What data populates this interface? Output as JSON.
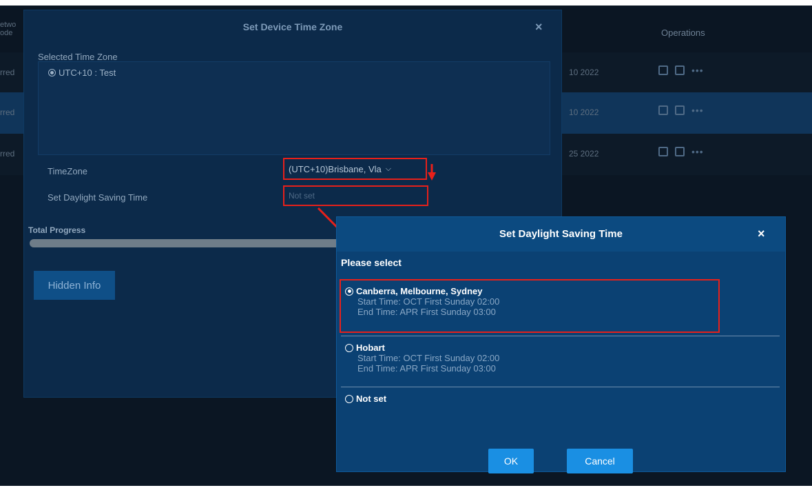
{
  "background": {
    "col_cut_top": "etwo",
    "col_cut_bottom": "ode",
    "operations_header": "Operations",
    "rows": [
      {
        "left": "rred",
        "date": "10 2022"
      },
      {
        "left": "rred",
        "date": "10 2022"
      },
      {
        "left": "rred",
        "date": "25 2022"
      }
    ]
  },
  "main_dialog": {
    "title": "Set Device Time Zone",
    "close": "×",
    "selected_label": "Selected Time Zone",
    "selected_item": "UTC+10 : Test",
    "timezone_label": "TimeZone",
    "timezone_value": "(UTC+10)Brisbane, Vla",
    "dst_label": "Set Daylight Saving Time",
    "dst_value": "Not set",
    "progress_label": "Total Progress",
    "progress": 1.0,
    "hidden_button": "Hidden Info"
  },
  "dst_dialog": {
    "title": "Set Daylight Saving Time",
    "close": "×",
    "prompt": "Please select",
    "options": [
      {
        "name": "Canberra, Melbourne, Sydney",
        "start": "Start Time: OCT First Sunday 02:00",
        "end": "End Time: APR First Sunday 03:00",
        "checked": true
      },
      {
        "name": "Hobart",
        "start": "Start Time: OCT First Sunday 02:00",
        "end": "End Time: APR First Sunday 03:00",
        "checked": false
      },
      {
        "name": "Not set",
        "checked": false
      }
    ],
    "ok": "OK",
    "cancel": "Cancel"
  },
  "colors": {
    "highlight": "#e8201a",
    "primary_button": "#1a8fe3",
    "dialog_header": "#0c4a80"
  }
}
